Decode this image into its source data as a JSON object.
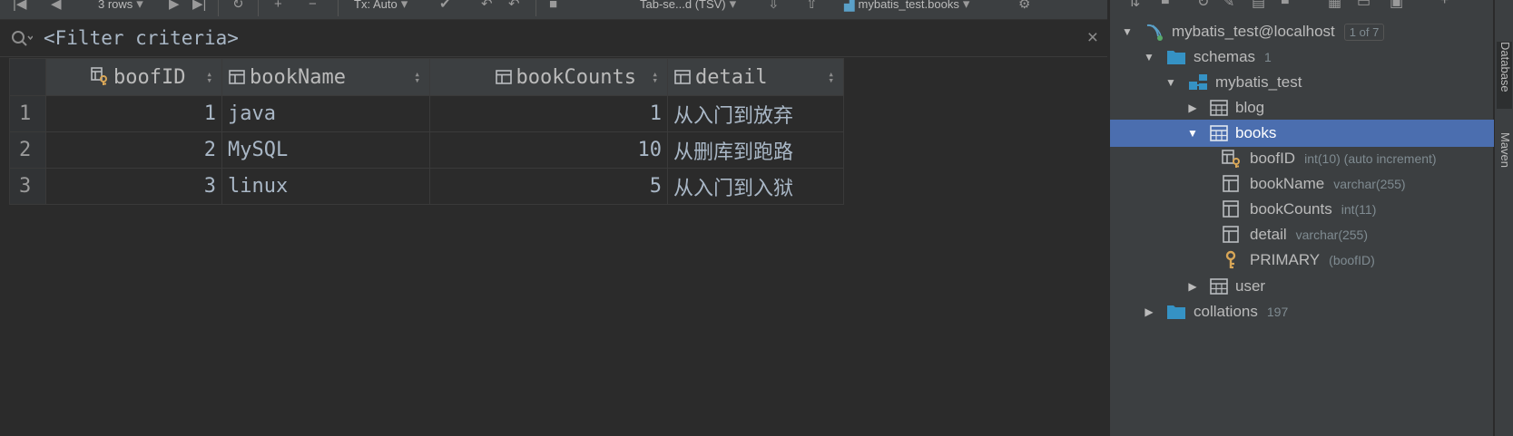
{
  "toolbar": {
    "rows_label": "3 rows",
    "tx_label": "Tx: Auto",
    "format_label": "Tab-se...d (TSV)",
    "datasource_label": "mybatis_test.books"
  },
  "filter": {
    "placeholder": "<Filter criteria>"
  },
  "grid": {
    "columns": [
      {
        "name": "boofID",
        "type": "key"
      },
      {
        "name": "bookName",
        "type": "col"
      },
      {
        "name": "bookCounts",
        "type": "col"
      },
      {
        "name": "detail",
        "type": "col"
      }
    ],
    "rows": [
      {
        "num": "1",
        "boofID": "1",
        "bookName": "java",
        "bookCounts": "1",
        "detail": "从入门到放弃"
      },
      {
        "num": "2",
        "boofID": "2",
        "bookName": "MySQL",
        "bookCounts": "10",
        "detail": "从删库到跑路"
      },
      {
        "num": "3",
        "boofID": "3",
        "bookName": "linux",
        "bookCounts": "5",
        "detail": "从入门到入狱"
      }
    ]
  },
  "tree": {
    "datasource": {
      "label": "mybatis_test@localhost",
      "badge": "1 of 7"
    },
    "schemas": {
      "label": "schemas",
      "count": "1"
    },
    "schema": {
      "label": "mybatis_test"
    },
    "blog": {
      "label": "blog"
    },
    "books": {
      "label": "books"
    },
    "columns": [
      {
        "label": "boofID",
        "meta": "int(10) (auto increment)"
      },
      {
        "label": "bookName",
        "meta": "varchar(255)"
      },
      {
        "label": "bookCounts",
        "meta": "int(11)"
      },
      {
        "label": "detail",
        "meta": "varchar(255)"
      }
    ],
    "primary": {
      "label": "PRIMARY",
      "meta": "(boofID)"
    },
    "user": {
      "label": "user"
    },
    "collations": {
      "label": "collations",
      "count": "197"
    }
  },
  "strip": {
    "tab1": "Database",
    "tab2": "Maven"
  },
  "colors": {
    "selected": "#4b6eaf",
    "background": "#2b2b2b",
    "panel": "#3c3f41",
    "key": "#d8a657"
  }
}
